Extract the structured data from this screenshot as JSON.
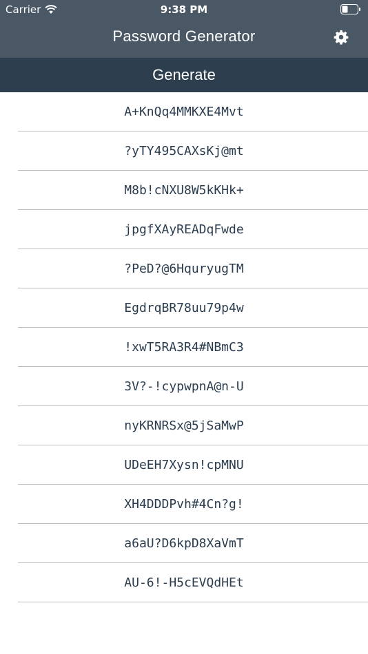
{
  "status_bar": {
    "carrier": "Carrier",
    "time": "9:38 PM"
  },
  "nav": {
    "title": "Password Generator",
    "settings_icon": "gear-icon"
  },
  "generate": {
    "label": "Generate"
  },
  "passwords": [
    "A+KnQq4MMKXE4Mvt",
    "?yTY495CAXsKj@mt",
    "M8b!cNXU8W5kKHk+",
    "jpgfXAyREADqFwde",
    "?PeD?@6HquryugTM",
    "EgdrqBR78uu79p4w",
    "!xwT5RA3R4#NBmC3",
    "3V?-!cypwpnA@n-U",
    "nyKRNRSx@5jSaMwP",
    "UDeEH7Xysn!cpMNU",
    "XH4DDDPvh#4Cn?g!",
    "a6aU?D6kpD8XaVmT",
    "AU-6!-H5cEVQdHEt"
  ],
  "colors": {
    "nav_background": "#4a5866",
    "generate_background": "#2d3e4f",
    "password_text": "#2a3c4e",
    "separator": "#bcbcc0"
  }
}
